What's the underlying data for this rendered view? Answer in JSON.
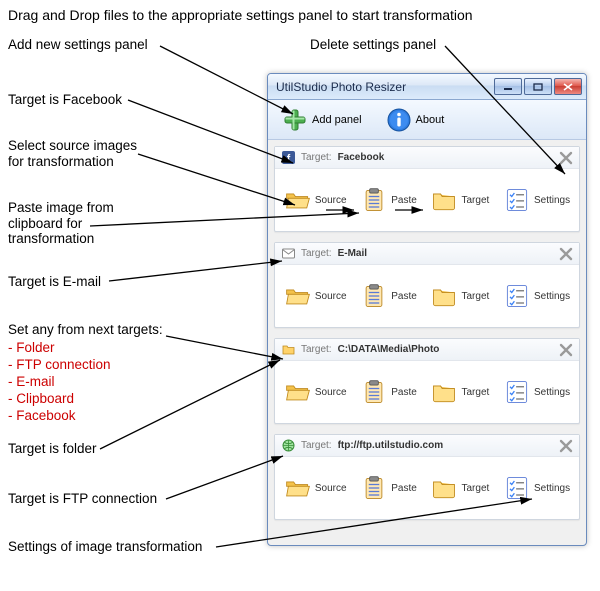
{
  "header_text": "Drag and Drop files to the appropriate settings panel to start transformation",
  "annotations": {
    "add_panel": "Add new settings panel",
    "delete_panel": "Delete settings panel",
    "target_facebook": "Target is Facebook",
    "select_source": "Select source images\nfor transformation",
    "paste_label": "Paste image from\nclipboard for\ntransformation",
    "target_email": "Target is E-mail",
    "set_targets_header": "Set any from next targets:",
    "set_targets_list": [
      "- Folder",
      "- FTP connection",
      "- E-mail",
      "- Clipboard",
      "- Facebook"
    ],
    "target_folder": "Target is folder",
    "target_ftp": "Target is FTP connection",
    "settings_label": "Settings of image transformation"
  },
  "window": {
    "title": "UtilStudio Photo Resizer",
    "toolbar": {
      "add_panel": "Add panel",
      "about": "About"
    },
    "target_label": "Target:",
    "actions": {
      "source": "Source",
      "paste": "Paste",
      "target": "Target",
      "settings": "Settings"
    },
    "panels": [
      {
        "icon": "facebook",
        "value": "Facebook"
      },
      {
        "icon": "email",
        "value": "E-Mail"
      },
      {
        "icon": "folder",
        "value": "C:\\DATA\\Media\\Photo"
      },
      {
        "icon": "ftp",
        "value": "ftp://ftp.utilstudio.com"
      }
    ]
  }
}
